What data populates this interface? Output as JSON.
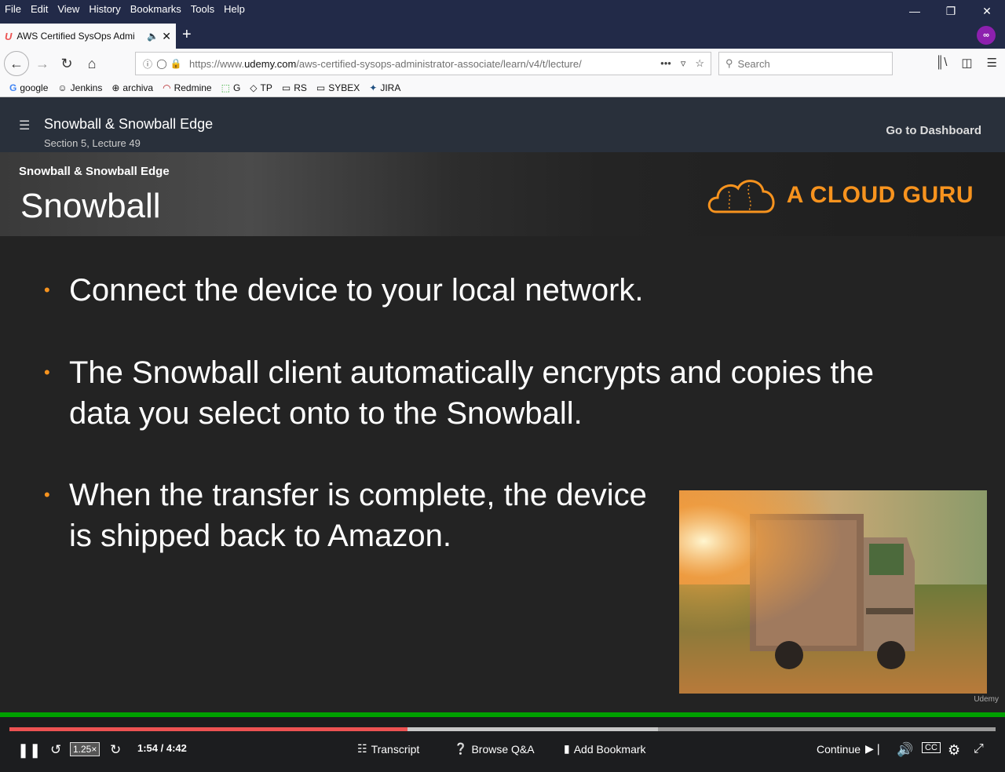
{
  "menu": [
    "File",
    "Edit",
    "View",
    "History",
    "Bookmarks",
    "Tools",
    "Help"
  ],
  "tab": {
    "title": "AWS Certified SysOps Admi",
    "favicon": "U"
  },
  "url": {
    "prefix": "https://www.",
    "domain": "udemy.com",
    "path": "/aws-certified-sysops-administrator-associate/learn/v4/t/lecture/"
  },
  "search": {
    "placeholder": "Search"
  },
  "bookmarks": [
    {
      "label": "google",
      "icon": "G"
    },
    {
      "label": "Jenkins",
      "icon": "☺"
    },
    {
      "label": "archiva",
      "icon": "⊕"
    },
    {
      "label": "Redmine",
      "icon": "◠"
    },
    {
      "label": "G",
      "icon": "⬚"
    },
    {
      "label": "TP",
      "icon": "◇"
    },
    {
      "label": "RS",
      "icon": "▭"
    },
    {
      "label": "SYBEX",
      "icon": "▭"
    },
    {
      "label": "JIRA",
      "icon": "✦"
    }
  ],
  "header": {
    "title": "Snowball & Snowball Edge",
    "subtitle": "Section 5, Lecture 49",
    "dashboard": "Go to Dashboard"
  },
  "slide": {
    "small_title": "Snowball & Snowball Edge",
    "big_title": "Snowball",
    "brand": "A CLOUD GURU",
    "bullets": [
      [
        "Connect the device to your local network."
      ],
      [
        "The Snowball client automatically encrypts and copies the",
        "data you select onto to the Snowball."
      ],
      [
        "When the transfer is complete, the device",
        "is shipped back to Amazon."
      ]
    ],
    "watermark": "Udemy"
  },
  "player": {
    "speed": "1.25×",
    "time": "1:54 / 4:42",
    "progress_fraction": 0.404,
    "buffered_fraction": 0.658,
    "transcript": "Transcript",
    "qa": "Browse Q&A",
    "bookmark": "Add Bookmark",
    "continue": "Continue"
  },
  "colors": {
    "accent": "#f7931e",
    "progress": "#ec5252",
    "header": "#29303b"
  }
}
